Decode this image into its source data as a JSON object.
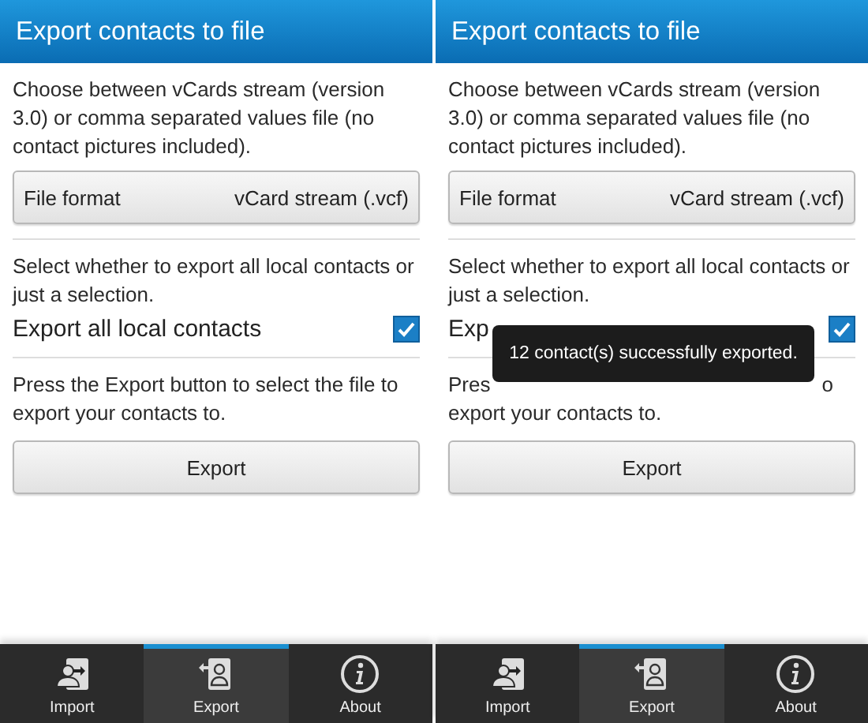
{
  "panes": [
    {
      "title": "Export contacts to file",
      "description": "Choose between vCards stream (version 3.0) or comma separated values file (no contact pictures included).",
      "file_format": {
        "label": "File format",
        "value": "vCard stream (.vcf)"
      },
      "scope_text": "Select whether to export all local contacts or just a selection.",
      "checkbox": {
        "label": "Export all local contacts",
        "checked": true
      },
      "export_text": "Press the Export button to select the file to export your contacts to.",
      "export_button": "Export",
      "tabs": [
        {
          "kind": "import",
          "label": "Import",
          "selected": false
        },
        {
          "kind": "export",
          "label": "Export",
          "selected": true
        },
        {
          "kind": "about",
          "label": "About",
          "selected": false
        }
      ]
    },
    {
      "title": "Export contacts to file",
      "description": "Choose between vCards stream (version 3.0) or comma separated values file (no contact pictures included).",
      "file_format": {
        "label": "File format",
        "value": "vCard stream (.vcf)"
      },
      "scope_text": "Select whether to export all local contacts or just a selection.",
      "checkbox": {
        "label": "Exp",
        "checked": true
      },
      "export_text_fragments": [
        "Pres",
        "o"
      ],
      "export_text": "export your contacts to.",
      "export_button": "Export",
      "toast": "12 contact(s) successfully exported.",
      "tabs": [
        {
          "kind": "import",
          "label": "Import",
          "selected": false
        },
        {
          "kind": "export",
          "label": "Export",
          "selected": true
        },
        {
          "kind": "about",
          "label": "About",
          "selected": false
        }
      ]
    }
  ]
}
